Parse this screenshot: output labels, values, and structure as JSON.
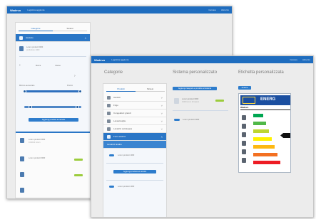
{
  "back_window": {
    "brand": "Wadevo",
    "nav_label": "Logistica aggiunta",
    "top_right": [
      "Cercare",
      "Abruzzo"
    ],
    "tabs": [
      "Categorie",
      "Sintesi"
    ],
    "selected_header": "Asciutto",
    "items": [
      {
        "title": "Lorem product 0000",
        "sub": "produttore 1000"
      },
      {
        "title": "Lorem product 0000",
        "sub": "10/2011 lorem"
      },
      {
        "title": "Lorem product 0000",
        "sub": "prodotto B"
      }
    ],
    "slider_label_left": "Minimo aumentare",
    "slider_label_right": "Prezzo",
    "button_label": "Aggiungi prodotto al carrello",
    "sort_labels": [
      "Marca",
      "Classe"
    ]
  },
  "front_window": {
    "brand": "Wadevo",
    "nav_label": "Logistica aggiunta",
    "top_right": [
      "Cercare",
      "Abruzzo"
    ],
    "heading_categories": "Categorie",
    "heading_system": "Sistema personalizzato",
    "heading_label": "Etichetta personalizzata",
    "tabs": [
      "Prodotti",
      "Sintesi"
    ],
    "categories": [
      {
        "name": "Asciutti",
        "selected": false
      },
      {
        "name": "Frigo",
        "selected": false
      },
      {
        "name": "Congelatori grandi",
        "selected": false
      },
      {
        "name": "Lavastoviglie",
        "selected": false
      },
      {
        "name": "Lavatrici sottotoppa",
        "selected": false
      },
      {
        "name": "Forni elettrici",
        "selected": true
      },
      {
        "name": "Lavatrici lavabo",
        "selected": true
      }
    ],
    "sub_item": "Lorem product 1000",
    "add_button": "Aggiungi prodotto al carrello",
    "sub_item_2": "Lorem product 1000",
    "system_button": "Aggiungi categoria e prodotto al sistema",
    "system_item": "Lorem product 0000",
    "system_item_sub": "1000 lorem 20 ipsum",
    "system_item_2": "Lorem product 0000",
    "label_button": "Scarica",
    "label_title": "ENERG",
    "label_brand": "Wadevo",
    "energy_colors": [
      "#00a651",
      "#50b848",
      "#bed630",
      "#fff200",
      "#fdb913",
      "#f37021",
      "#ed1c24"
    ]
  }
}
